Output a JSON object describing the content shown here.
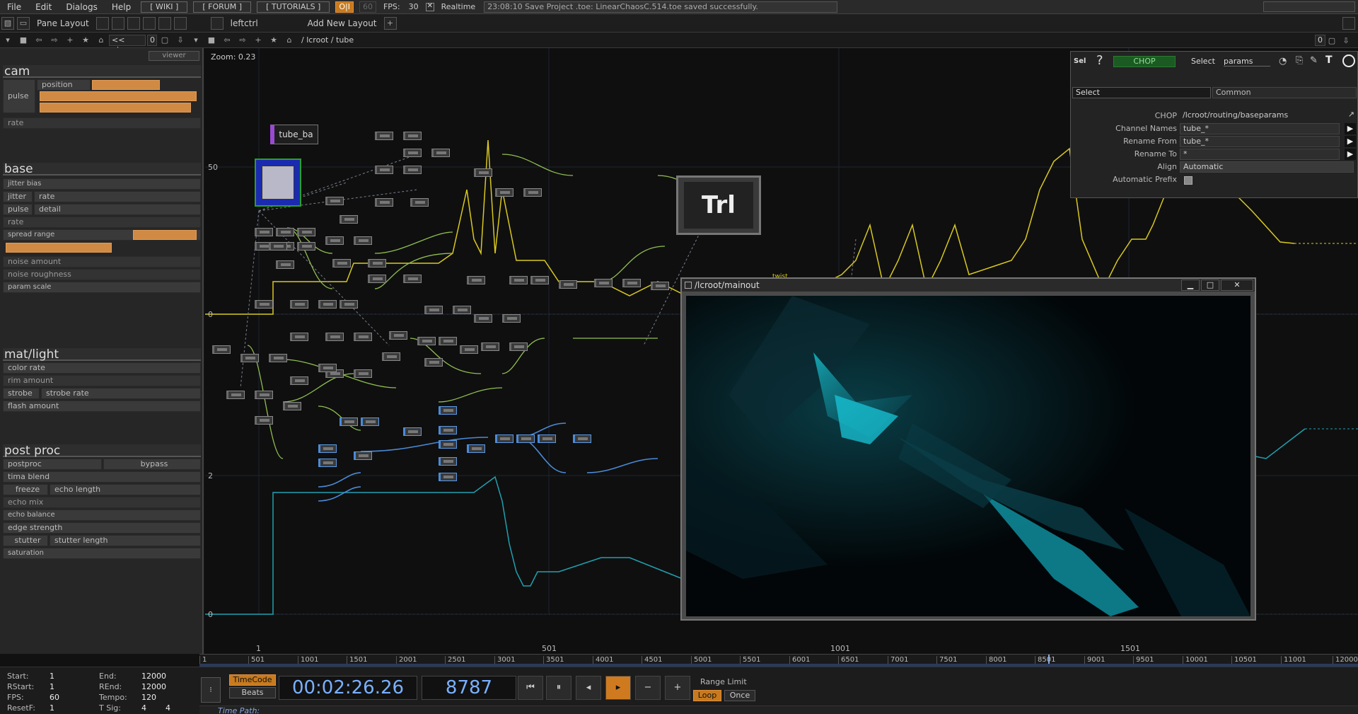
{
  "menu": {
    "items": [
      "File",
      "Edit",
      "Dialogs",
      "Help"
    ],
    "wiki": "[ WIKI ]",
    "forum": "[ FORUM ]",
    "tutorials": "[ TUTORIALS ]",
    "oi": "O|I",
    "sixty": "60",
    "fps_label": "FPS:",
    "fps_value": "30",
    "realtime": "Realtime",
    "status": "23:08:10 Save Project .toe: LinearChaosC.514.toe saved successfully."
  },
  "layoutbar": {
    "pane_layout": "Pane Layout",
    "leftctrl": "leftctrl",
    "add_layout": "Add New Layout"
  },
  "pathbar": {
    "left_path": "<< uicor",
    "left_num": "0",
    "right_path": "/ lcroot / tube",
    "right_num": "0"
  },
  "leftpanel": {
    "viewer": "viewer",
    "sections": {
      "cam": "cam",
      "base": "base",
      "matlight": "mat/light",
      "postproc": "post proc"
    },
    "cam": {
      "position": "position",
      "pulse": "pulse",
      "rate": "rate"
    },
    "base": {
      "jitter_bias": "jitter bias",
      "jitter": "jitter",
      "rate": "rate",
      "pulse": "pulse",
      "detail": "detail",
      "rate2": "rate",
      "spread_range": "spread range",
      "noise_amount": "noise amount",
      "noise_roughness": "noise roughness",
      "param_scale": "param scale"
    },
    "matlight": {
      "color_rate": "color rate",
      "rim_amount": "rim amount",
      "strobe": "strobe",
      "strobe_rate": "strobe rate",
      "flash_amount": "flash amount"
    },
    "postproc": {
      "postproc": "postproc",
      "bypass": "bypass",
      "tima_blend": "tima blend",
      "freeze": "freeze",
      "echo_length": "echo length",
      "echo_mix": "echo mix",
      "echo_balance": "echo balance",
      "edge_strength": "edge strength",
      "stutter": "stutter",
      "stutter_length": "stutter length",
      "saturation": "saturation"
    }
  },
  "network": {
    "zoom": "Zoom: 0.23",
    "y_ticks": [
      "50",
      "0",
      "2",
      "0"
    ],
    "x_ticks": [
      "1",
      "501",
      "1001",
      "1501"
    ],
    "tube_node": "tube_ba",
    "trl_node": "Trl",
    "twist_label": "twist"
  },
  "params": {
    "sel": "Sel",
    "help": "?",
    "type": "CHOP",
    "select_label": "Select",
    "select_value": "params",
    "tab_select": "Select",
    "tab_common": "Common",
    "rows": [
      {
        "label": "CHOP",
        "value": "/lcroot/routing/baseparams"
      },
      {
        "label": "Channel Names",
        "value": "tube_*"
      },
      {
        "label": "Rename From",
        "value": "tube_*"
      },
      {
        "label": "Rename To",
        "value": "*"
      },
      {
        "label": "Align",
        "value": "Automatic"
      },
      {
        "label": "Automatic Prefix",
        "value": ""
      }
    ],
    "t_icon": "T"
  },
  "viewer": {
    "title": "/lcroot/mainout",
    "minimize": "▁",
    "maximize": "□",
    "close": "✕"
  },
  "timeline": {
    "ticks": [
      "1",
      "501",
      "1001",
      "1501",
      "2001",
      "2501",
      "3001",
      "3501",
      "4001",
      "4501",
      "5001",
      "5501",
      "6001",
      "6501",
      "7001",
      "7501",
      "8001",
      "8501",
      "9001",
      "9501",
      "10001",
      "10501",
      "11001",
      "12000"
    ]
  },
  "timectrl": {
    "start_label": "Start:",
    "start": "1",
    "rstart_label": "RStart:",
    "rstart": "1",
    "fps_label": "FPS:",
    "fps": "60",
    "resetf_label": "ResetF:",
    "resetf": "1",
    "end_label": "End:",
    "end": "12000",
    "rend_label": "REnd:",
    "rend": "12000",
    "tempo_label": "Tempo:",
    "tempo": "120",
    "tsig_label": "T Sig:",
    "tsig_a": "4",
    "tsig_b": "4",
    "timecode": "TimeCode",
    "beats": "Beats",
    "time": "00:02:26.26",
    "frame": "8787",
    "range_limit": "Range Limit",
    "loop": "Loop",
    "once": "Once",
    "time_path": "Time Path:"
  },
  "colors": {
    "accent_orange": "#d08a44",
    "curve_yellow": "#d8c820",
    "curve_cyan": "#20a0b0",
    "link_green": "#8fbf50",
    "link_blue": "#4a8ad8"
  }
}
